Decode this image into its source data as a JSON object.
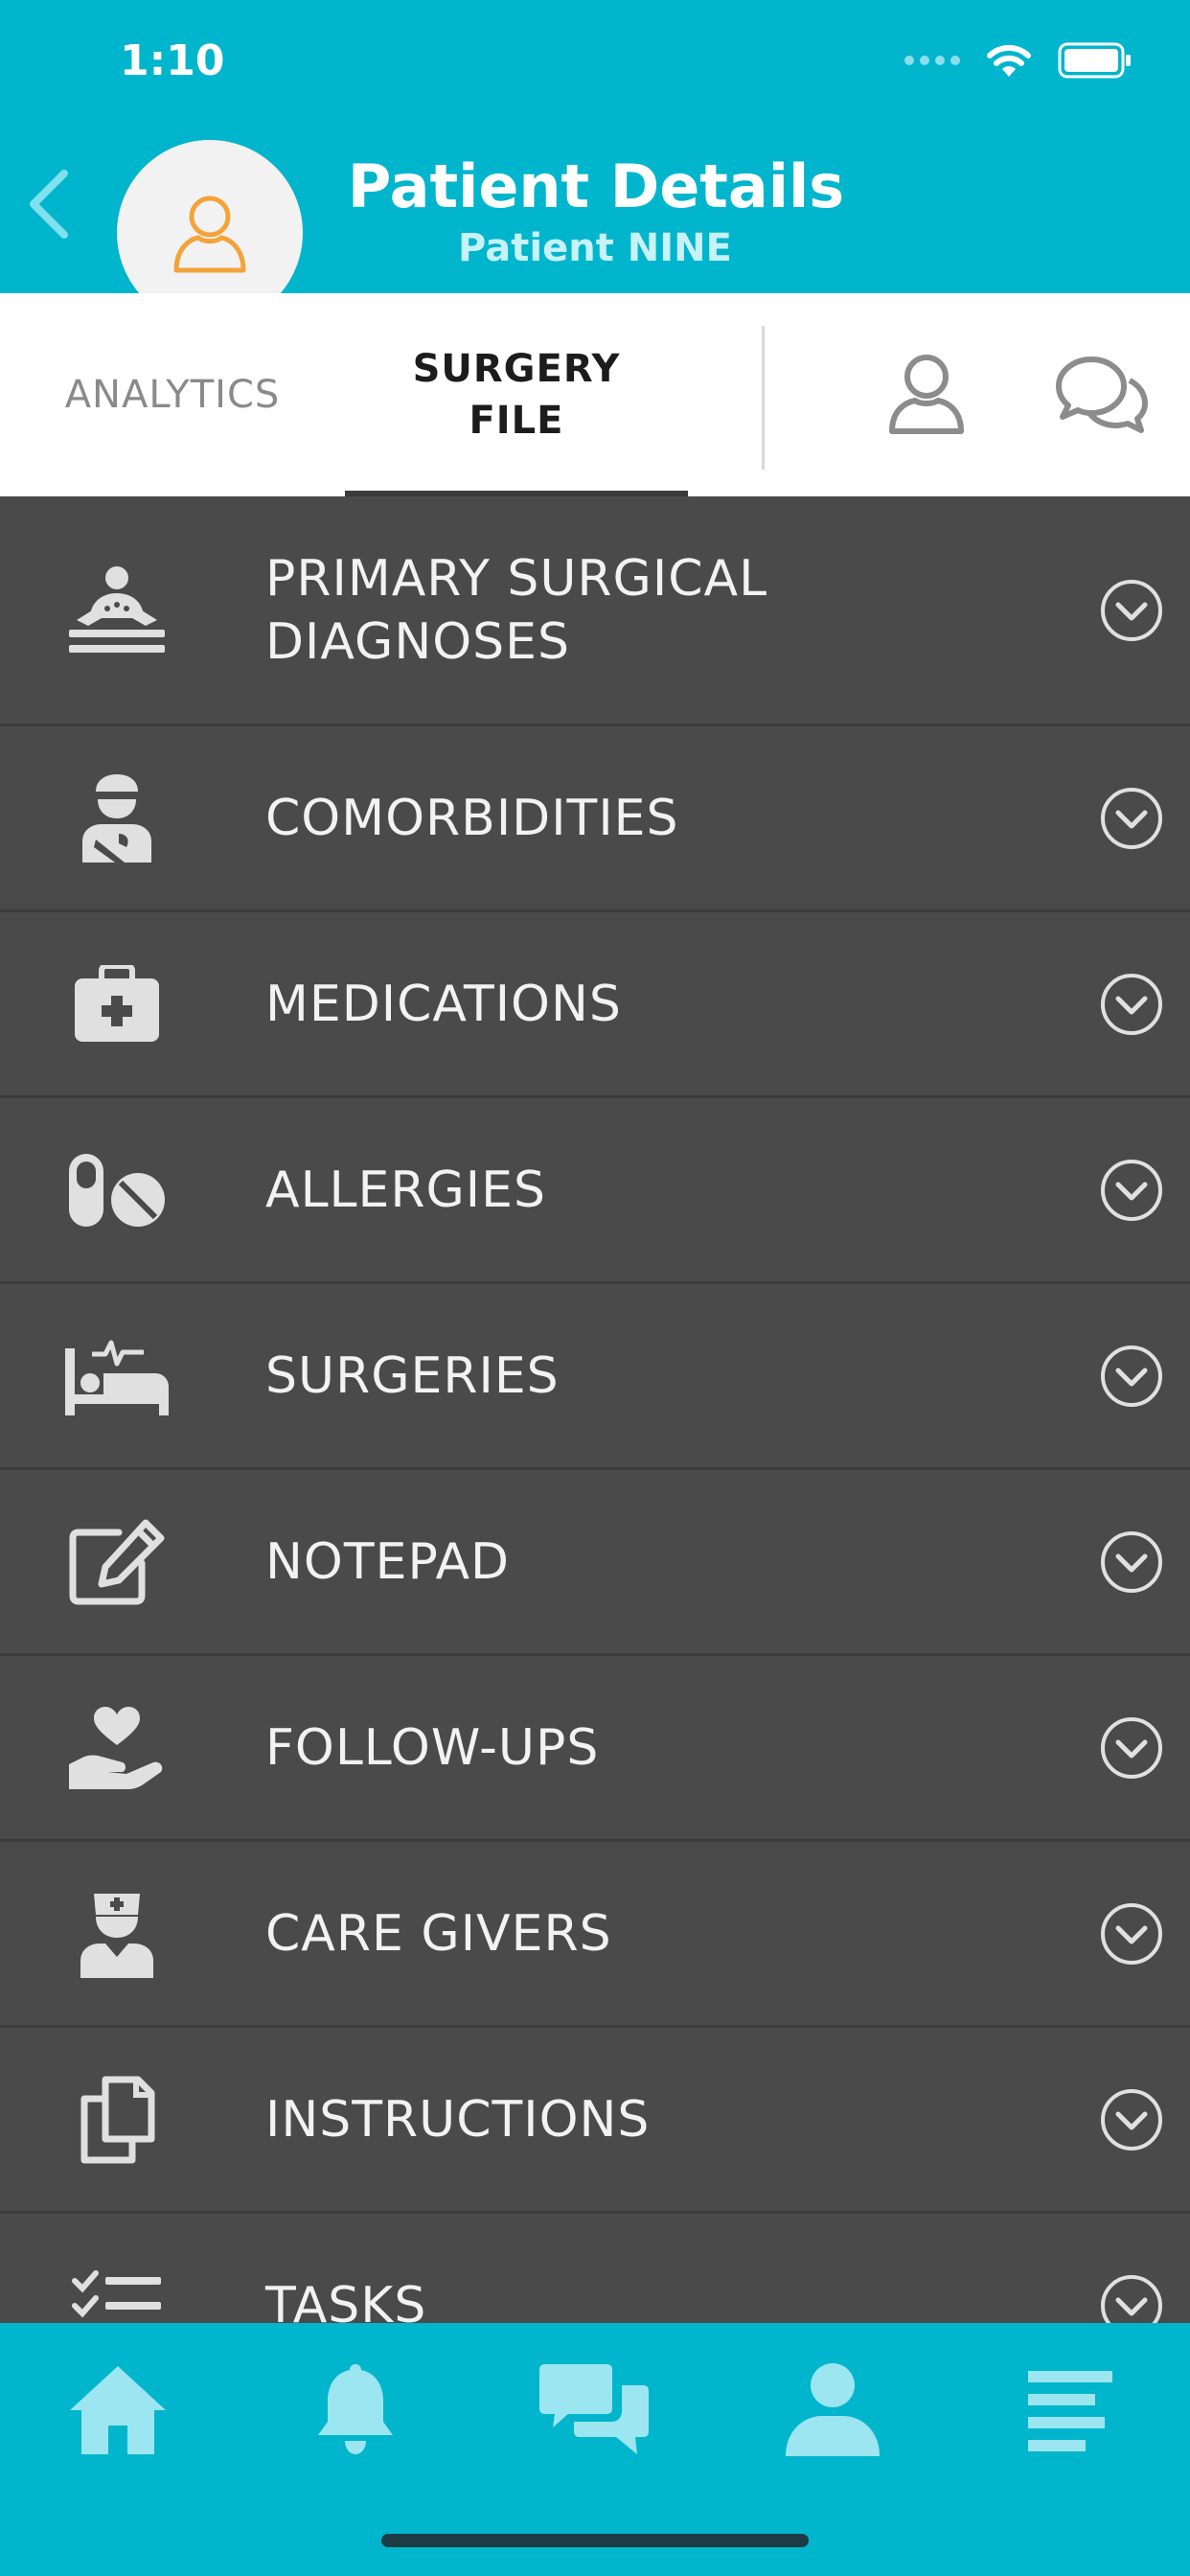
{
  "status_bar": {
    "time": "1:10"
  },
  "header": {
    "title": "Patient Details",
    "subtitle": "Patient NINE"
  },
  "tabs": {
    "analytics": "ANALYTICS",
    "surgery_line1": "SURGERY",
    "surgery_line2": "FILE"
  },
  "sections": [
    {
      "label_line1": "PRIMARY SURGICAL",
      "label_line2": "DIAGNOSES",
      "icon": "patient-bed-icon"
    },
    {
      "label": "COMORBIDITIES",
      "icon": "injured-person-icon"
    },
    {
      "label": "MEDICATIONS",
      "icon": "medical-kit-icon"
    },
    {
      "label": "ALLERGIES",
      "icon": "pills-icon"
    },
    {
      "label": "SURGERIES",
      "icon": "hospital-bed-icon"
    },
    {
      "label": "NOTEPAD",
      "icon": "edit-icon"
    },
    {
      "label": "FOLLOW-UPS",
      "icon": "hand-heart-icon"
    },
    {
      "label": "CARE GIVERS",
      "icon": "nurse-icon"
    },
    {
      "label": "INSTRUCTIONS",
      "icon": "copy-icon"
    },
    {
      "label": "TASKS",
      "icon": "checklist-icon"
    }
  ],
  "bottom_nav": [
    "home-icon",
    "bell-icon",
    "chat-icon",
    "user-icon",
    "menu-icon"
  ],
  "colors": {
    "primary": "#00b5cc",
    "list_bg": "#4a4a4a",
    "avatar_accent": "#f2a33a",
    "nav_icon": "#9be6f0"
  }
}
